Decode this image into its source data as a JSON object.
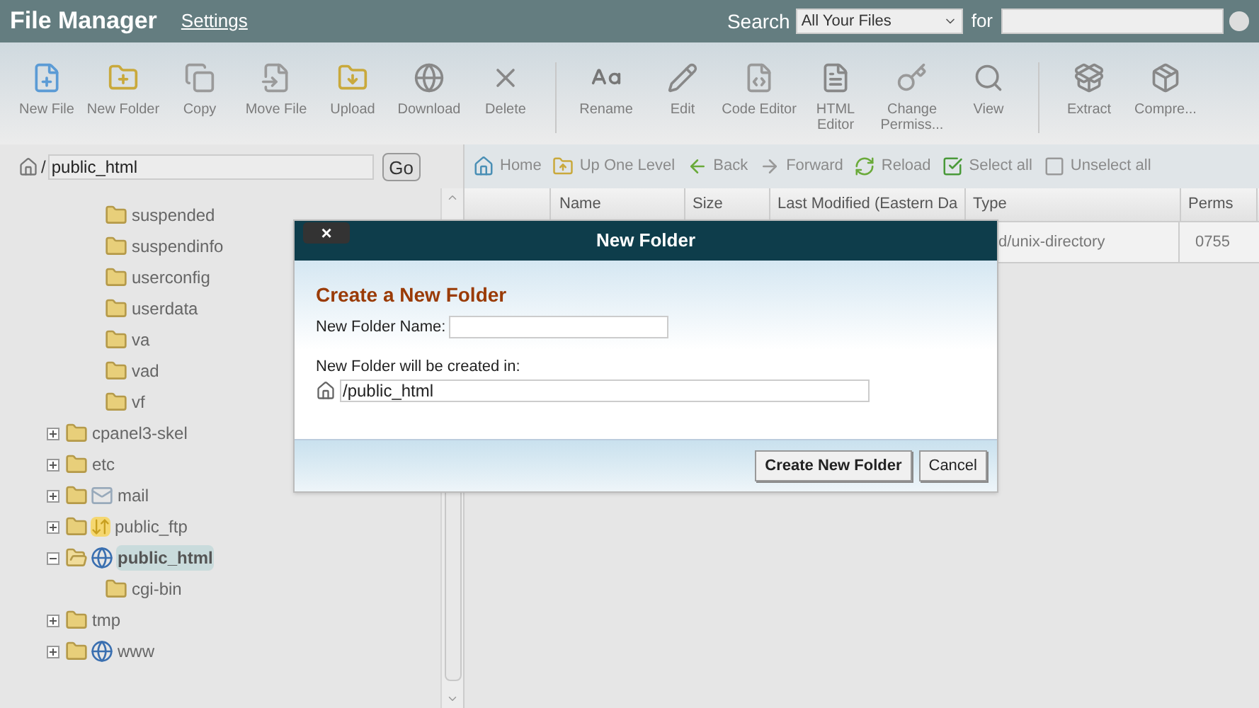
{
  "header": {
    "title": "File Manager",
    "settings_link": "Settings",
    "search_label": "Search",
    "search_scope": "All Your Files",
    "for_label": "for"
  },
  "toolbar": [
    [
      {
        "label": "New File"
      },
      {
        "label": "New Folder"
      },
      {
        "label": "Copy"
      },
      {
        "label": "Move File"
      },
      {
        "label": "Upload"
      },
      {
        "label": "Download"
      },
      {
        "label": "Delete"
      }
    ],
    [
      {
        "label": "Rename"
      },
      {
        "label": "Edit"
      },
      {
        "label": "Code Editor"
      },
      {
        "label": "HTML Editor"
      },
      {
        "label": "Change Permiss..."
      },
      {
        "label": "View"
      }
    ],
    [
      {
        "label": "Extract"
      },
      {
        "label": "Compre..."
      }
    ]
  ],
  "path_bar": {
    "root": "/",
    "value": "public_html",
    "go": "Go"
  },
  "tree": [
    {
      "children": [
        {
          "label": "suspended"
        },
        {
          "label": "suspendinfo"
        },
        {
          "label": "userconfig"
        },
        {
          "label": "userdata"
        },
        {
          "label": "va"
        },
        {
          "label": "vad"
        },
        {
          "label": "vf"
        }
      ]
    },
    {
      "label": "cpanel3-skel",
      "expanded": false,
      "selected": false
    },
    {
      "label": "etc",
      "expanded": false,
      "selected": false
    },
    {
      "label": "mail",
      "kind": "mail",
      "expanded": false,
      "selected": false
    },
    {
      "label": "public_ftp",
      "kind": "ftp",
      "expanded": false,
      "selected": false
    },
    {
      "label": "public_html",
      "kind": "web",
      "expanded": true,
      "selected": true,
      "children": [
        {
          "label": "cgi-bin"
        }
      ]
    },
    {
      "label": "tmp",
      "expanded": false,
      "selected": false
    },
    {
      "label": "www",
      "kind": "web",
      "expanded": false,
      "selected": false
    }
  ],
  "nav": [
    {
      "label": "Home"
    },
    {
      "label": "Up One Level"
    },
    {
      "label": "Back"
    },
    {
      "label": "Forward"
    },
    {
      "label": "Reload"
    },
    {
      "label": "Select all"
    },
    {
      "label": "Unselect all"
    }
  ],
  "table": {
    "columns": [
      "Name",
      "Size",
      "Last Modified (Eastern Da",
      "Type",
      "Perms"
    ],
    "rows": [
      {
        "type": "d/unix-directory",
        "perms": "0755"
      }
    ]
  },
  "dialog": {
    "title": "New Folder",
    "close": "×",
    "heading": "Create a New Folder",
    "name_label": "New Folder Name:",
    "location_label": "New Folder will be created in:",
    "location": "/public_html",
    "buttons": [
      "Create New Folder",
      "Cancel"
    ]
  }
}
